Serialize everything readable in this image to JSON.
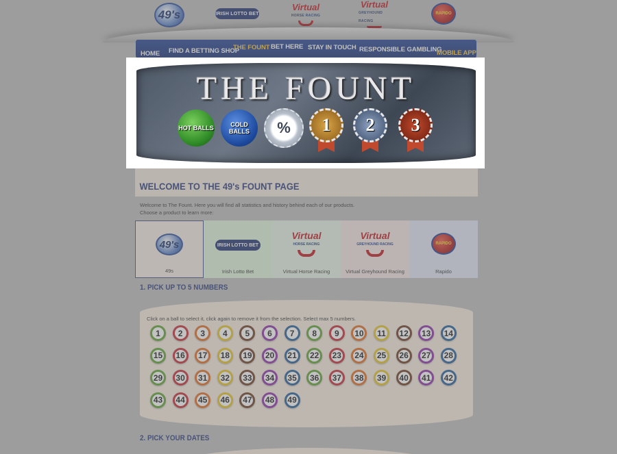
{
  "brand_bar": {
    "logos": [
      {
        "name": "49s",
        "text": "49's"
      },
      {
        "name": "irish-lotto-bet",
        "text": "IRISH LOTTO BET"
      },
      {
        "name": "virtual-horse-racing",
        "text": "Virtual",
        "sub": "HORSE RACING"
      },
      {
        "name": "virtual-greyhound-racing",
        "text": "Virtual",
        "sub": "GREYHOUND RACING"
      },
      {
        "name": "rapido",
        "text": "RAPIDO"
      }
    ]
  },
  "nav": {
    "items": [
      "HOME",
      "FIND A BETTING SHOP",
      "THE FOUNT",
      "BET HERE",
      "STAY IN TOUCH",
      "RESPONSIBLE GAMBLING",
      "MOBILE APP"
    ],
    "active": "THE FOUNT"
  },
  "hero": {
    "title": "THE FOUNT",
    "hot_balls": "HOT BALLS",
    "cold_balls": "COLD BALLS",
    "percent": "%",
    "medals": [
      "1",
      "2",
      "3"
    ]
  },
  "welcome": {
    "heading": "WELCOME TO THE 49's FOUNT PAGE",
    "intro_line1": "Welcome to The Fount. Here you will find all statistics and history behind each of our products.",
    "intro_line2": "Choose a product to learn more:"
  },
  "products": [
    {
      "label": "49s",
      "logo": "49's"
    },
    {
      "label": "Irish Lotto Bet",
      "logo": "IRISH LOTTO BET"
    },
    {
      "label": "Virtual Horse Racing",
      "logo": "Virtual",
      "sub": "HORSE RACING"
    },
    {
      "label": "Virtual Greyhound Racing",
      "logo": "Virtual",
      "sub": "GREYHOUND RACING"
    },
    {
      "label": "Rapido",
      "logo": "RAPIDO"
    }
  ],
  "pick_numbers": {
    "heading": "1. PICK UP TO 5 NUMBERS",
    "hint": "Click on a ball to select it, click again to remove it from the selection. Select max 5 numbers.",
    "ball_colors": [
      "#5aa02c",
      "#c4262e",
      "#e0681c",
      "#e6c21e",
      "#6b3a1e",
      "#8a2aa6",
      "#1e5a96"
    ],
    "balls": [
      "1",
      "2",
      "3",
      "4",
      "5",
      "6",
      "7",
      "8",
      "9",
      "10",
      "11",
      "12",
      "13",
      "14",
      "15",
      "16",
      "17",
      "18",
      "19",
      "20",
      "21",
      "22",
      "23",
      "24",
      "25",
      "26",
      "27",
      "28",
      "29",
      "30",
      "31",
      "32",
      "33",
      "34",
      "35",
      "36",
      "37",
      "38",
      "39",
      "40",
      "41",
      "42",
      "43",
      "44",
      "45",
      "46",
      "47",
      "48",
      "49"
    ]
  },
  "pick_dates": {
    "heading": "2. PICK YOUR DATES"
  }
}
